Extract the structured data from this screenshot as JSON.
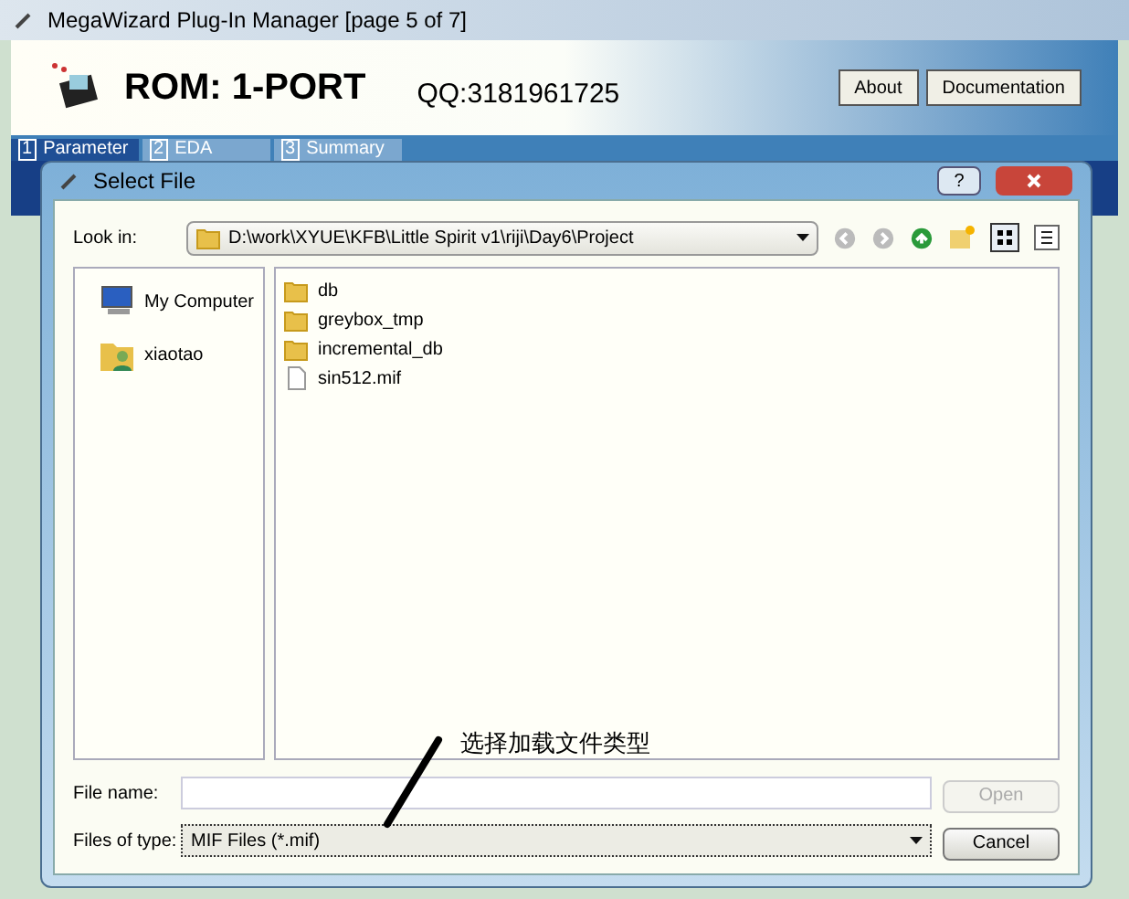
{
  "window": {
    "title": "MegaWizard Plug-In Manager [page 5 of 7]"
  },
  "header": {
    "title": "ROM: 1-PORT",
    "note": "QQ:3181961725",
    "buttons": [
      "About",
      "Documentation"
    ]
  },
  "tabs": [
    {
      "number": "1",
      "label": "Parameter",
      "selected": true
    },
    {
      "number": "2",
      "label": "EDA",
      "selected": false
    },
    {
      "number": "3",
      "label": "Summary",
      "selected": false
    }
  ],
  "dialog": {
    "title": "Select File",
    "help": "?",
    "look_in_label": "Look in:",
    "look_in": "D:\\work\\XYUE\\KFB\\Little Spirit v1\\riji\\Day6\\Project",
    "places": [
      {
        "kind": "computer",
        "label": "My Computer"
      },
      {
        "kind": "user",
        "label": "xiaotao"
      }
    ],
    "files": [
      {
        "kind": "folder",
        "name": "db"
      },
      {
        "kind": "folder",
        "name": "greybox_tmp"
      },
      {
        "kind": "folder",
        "name": "incremental_db"
      },
      {
        "kind": "file",
        "name": "sin512.mif"
      }
    ],
    "file_name_label": "File name:",
    "files_of_type_label": "Files of type:",
    "files_of_type": "MIF Files (*.mif)",
    "open_button": {
      "label": "Open",
      "disabled": true
    },
    "cancel_button": {
      "label": "Cancel",
      "disabled": false
    }
  },
  "annotation": "选择加载文件类型"
}
